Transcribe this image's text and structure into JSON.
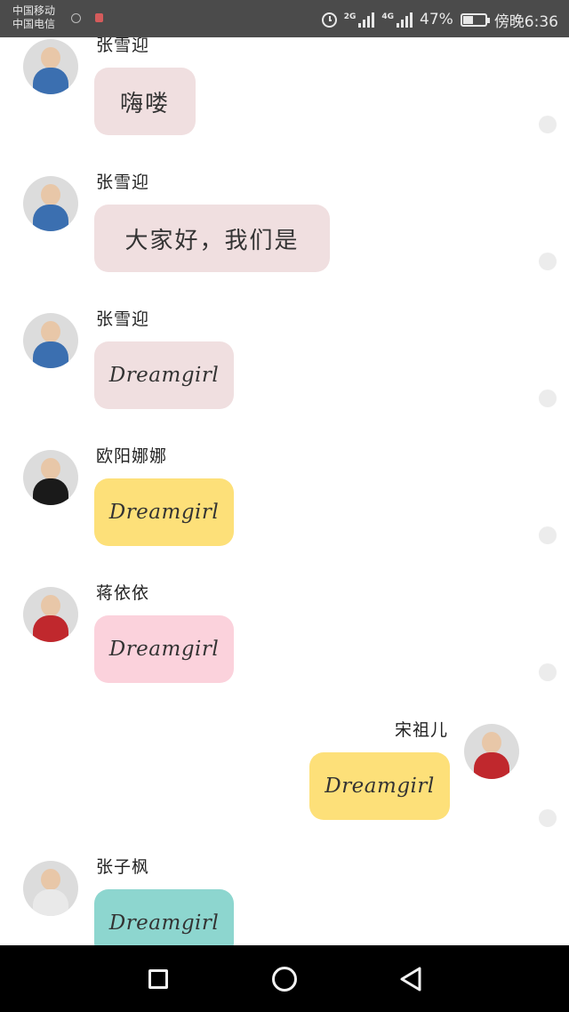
{
  "status_bar": {
    "carrier_line1": "中国移动",
    "carrier_line2": "中国电信",
    "signal1_label": "2G",
    "signal2_label": "4G",
    "battery_percent": "47%",
    "battery_level": 0.47,
    "time": "傍晚6:36",
    "icons": [
      "sim-icon",
      "notification-icon",
      "alarm-icon",
      "signal-icon",
      "battery-icon"
    ]
  },
  "messages": [
    {
      "sender": "张雪迎",
      "text": "嗨喽",
      "side": "left",
      "bubble_color": "#f0dfe0",
      "avatar_color": "#3b6fb0"
    },
    {
      "sender": "张雪迎",
      "text": "大家好，我们是",
      "side": "left",
      "bubble_color": "#f0dfe0",
      "avatar_color": "#3b6fb0"
    },
    {
      "sender": "张雪迎",
      "text": "Dreamgirl",
      "side": "left",
      "bubble_color": "#f0dfe0",
      "avatar_color": "#3b6fb0"
    },
    {
      "sender": "欧阳娜娜",
      "text": "Dreamgirl",
      "side": "left",
      "bubble_color": "#fde079",
      "avatar_color": "#1a1a1a"
    },
    {
      "sender": "蒋依依",
      "text": "Dreamgirl",
      "side": "left",
      "bubble_color": "#fbd2dc",
      "avatar_color": "#c0282d"
    },
    {
      "sender": "宋祖儿",
      "text": "Dreamgirl",
      "side": "right",
      "bubble_color": "#fde079",
      "avatar_color": "#c0282d"
    },
    {
      "sender": "张子枫",
      "text": "Dreamgirl",
      "side": "left",
      "bubble_color": "#8dd6cf",
      "avatar_color": "#e9e9e9"
    }
  ],
  "nav_bar": {
    "buttons": [
      "recent-apps",
      "home",
      "back"
    ]
  }
}
